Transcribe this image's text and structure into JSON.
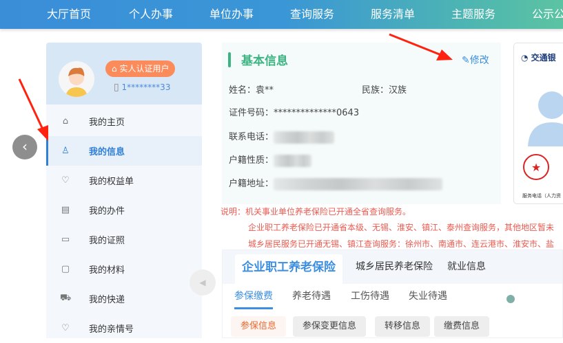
{
  "nav": [
    "大厅首页",
    "个人办事",
    "单位办事",
    "查询服务",
    "服务清单",
    "主题服务",
    "公示公"
  ],
  "profile": {
    "badge": "实人认证用户",
    "phone": "1********33"
  },
  "menu": [
    {
      "label": "我的主页",
      "icon": "home-icon"
    },
    {
      "label": "我的信息",
      "icon": "user-icon"
    },
    {
      "label": "我的权益单",
      "icon": "diamond-icon"
    },
    {
      "label": "我的办件",
      "icon": "document-icon"
    },
    {
      "label": "我的证照",
      "icon": "id-card-icon"
    },
    {
      "label": "我的材料",
      "icon": "box-icon"
    },
    {
      "label": "我的快递",
      "icon": "truck-icon"
    },
    {
      "label": "我的亲情号",
      "icon": "heart-icon"
    }
  ],
  "info": {
    "title": "基本信息",
    "edit": "修改",
    "name_label": "姓名：",
    "name": "袁**",
    "ethnic_label": "民族：",
    "ethnic": "汉族",
    "id_label": "证件号码：",
    "id": "**************0643",
    "phone_label": "联系电话：",
    "hukou_type_label": "户籍性质：",
    "hukou_addr_label": "户籍地址："
  },
  "card": {
    "bank": "交通银",
    "service": "服务电话（人力资"
  },
  "notes": [
    "说明：机关事业单位养老保险已开通全省查询服务。",
    "企业职工养老保险已开通省本级、无锡、淮安、镇江、泰州查询服务，其他地区暂未",
    "城乡居民服务已开通无锡、镇江查询服务：徐州市、南通市、连云港市、淮安市、盐"
  ],
  "tabs": [
    "企业职工养老保险",
    "城乡居民养老保险",
    "就业信息"
  ],
  "subtabs": [
    "参保缴费",
    "养老待遇",
    "工伤待遇",
    "失业待遇"
  ],
  "buttons": [
    "参保信息",
    "参保变更信息",
    "转移信息",
    "缴费信息"
  ],
  "colors": {
    "accent": "#3b8ee0",
    "green": "#3cb482",
    "note": "#ec5a50",
    "orange": "#fb8b5a"
  }
}
